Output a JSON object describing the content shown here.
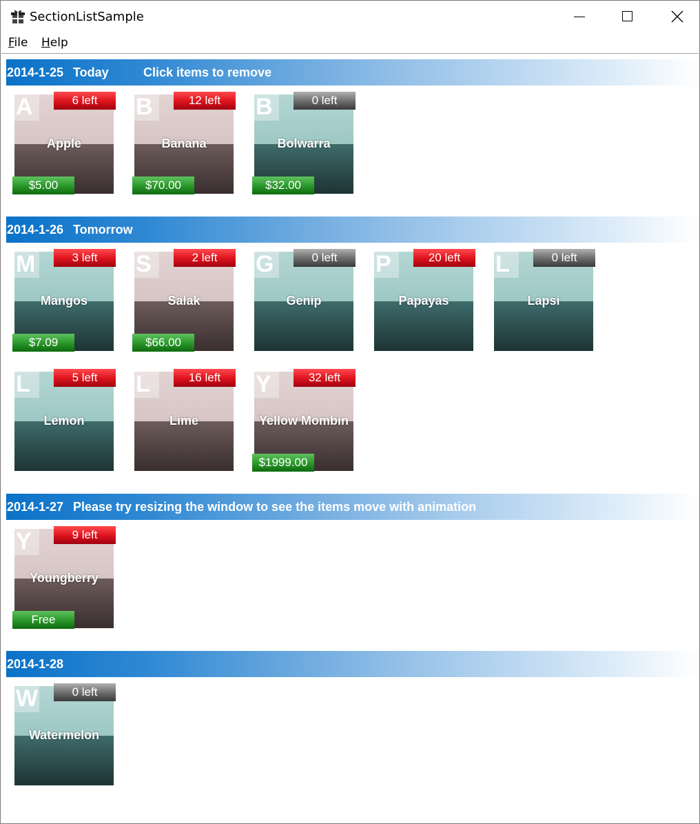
{
  "window": {
    "title": "SectionListSample"
  },
  "menu": {
    "items": [
      {
        "label": "File",
        "accel": "F",
        "rest": "ile"
      },
      {
        "label": "Help",
        "accel": "H",
        "rest": "elp"
      }
    ]
  },
  "colors": {
    "header_blue": "#0a72c8",
    "stock_red": "#e0161f",
    "stock_gray": "#6a6a6a",
    "price_green": "#2c9a2c",
    "tile_teal_top": "#9dc8c4",
    "tile_teal_bottom": "#1d3434",
    "tile_mauve_top": "#d7c5c5",
    "tile_mauve_bottom": "#3a2e2e"
  },
  "sections": [
    {
      "date": "2014-1-25",
      "title": "Today",
      "subtitle": "Click items to remove",
      "items": [
        {
          "letter": "A",
          "name": "Apple",
          "stock": "6 left",
          "price": "$5.00",
          "color": "mauve",
          "stock_color": "red"
        },
        {
          "letter": "B",
          "name": "Banana",
          "stock": "12 left",
          "price": "$70.00",
          "color": "mauve",
          "stock_color": "red"
        },
        {
          "letter": "B",
          "name": "Bolwarra",
          "stock": "0 left",
          "price": "$32.00",
          "color": "teal",
          "stock_color": "gray"
        }
      ]
    },
    {
      "date": "2014-1-26",
      "title": "Tomorrow",
      "subtitle": "",
      "items": [
        {
          "letter": "M",
          "name": "Mangos",
          "stock": "3 left",
          "price": "$7.09",
          "color": "teal",
          "stock_color": "red"
        },
        {
          "letter": "S",
          "name": "Salak",
          "stock": "2 left",
          "price": "$66.00",
          "color": "mauve",
          "stock_color": "red"
        },
        {
          "letter": "G",
          "name": "Genip",
          "stock": "0 left",
          "price": "",
          "color": "teal",
          "stock_color": "gray"
        },
        {
          "letter": "P",
          "name": "Papayas",
          "stock": "20 left",
          "price": "",
          "color": "teal",
          "stock_color": "red"
        },
        {
          "letter": "L",
          "name": "Lapsi",
          "stock": "0 left",
          "price": "",
          "color": "teal",
          "stock_color": "gray"
        },
        {
          "letter": "L",
          "name": "Lemon",
          "stock": "5 left",
          "price": "",
          "color": "teal",
          "stock_color": "red"
        },
        {
          "letter": "L",
          "name": "Lime",
          "stock": "16 left",
          "price": "",
          "color": "mauve",
          "stock_color": "red"
        },
        {
          "letter": "Y",
          "name": "Yellow Mombin",
          "stock": "32 left",
          "price": "$1999.00",
          "color": "mauve",
          "stock_color": "red"
        }
      ]
    },
    {
      "date": "2014-1-27",
      "title": "Please try resizing the window to see the items move with animation",
      "subtitle": "",
      "items": [
        {
          "letter": "Y",
          "name": "Youngberry",
          "stock": "9 left",
          "price": "Free",
          "color": "mauve",
          "stock_color": "red"
        }
      ]
    },
    {
      "date": "2014-1-28",
      "title": "",
      "subtitle": "",
      "items": [
        {
          "letter": "W",
          "name": "Watermelon",
          "stock": "0 left",
          "price": "",
          "color": "teal",
          "stock_color": "gray"
        }
      ]
    }
  ]
}
